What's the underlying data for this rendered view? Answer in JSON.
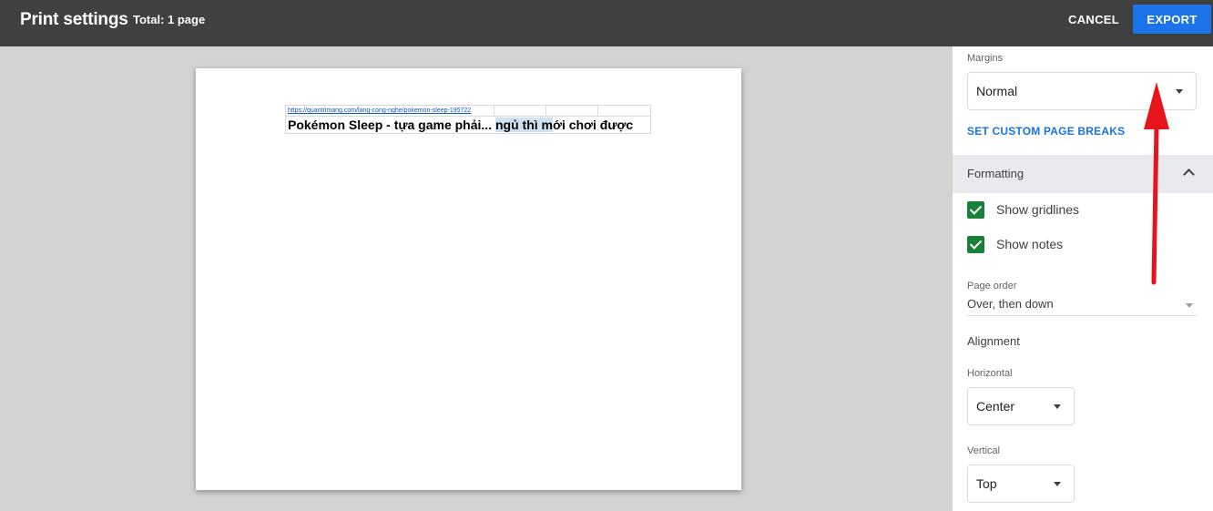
{
  "header": {
    "title": "Print settings",
    "total": "Total: 1 page",
    "cancel_label": "CANCEL",
    "export_label": "EXPORT",
    "export_color": "#1a73e8"
  },
  "preview": {
    "url": "https://quantrimang.com/lang-cong-nghe/pokemon-sleep-195722",
    "title_part1": "Pokémon Sleep - tựa game phải... ",
    "title_highlight": "ngủ thì m",
    "title_part2": "ới chơi được"
  },
  "panel": {
    "margins_label": "Margins",
    "margins_value": "Normal",
    "custom_breaks": "SET CUSTOM PAGE BREAKS",
    "formatting_label": "Formatting",
    "show_gridlines": "Show gridlines",
    "show_notes": "Show notes",
    "page_order_label": "Page order",
    "page_order_value": "Over, then down",
    "alignment_label": "Alignment",
    "horizontal_label": "Horizontal",
    "horizontal_value": "Center",
    "vertical_label": "Vertical",
    "vertical_value": "Top",
    "checkbox_color": "#188038"
  },
  "annotation": {
    "arrow_color": "#e8141b",
    "icon": "red-arrow-icon"
  }
}
